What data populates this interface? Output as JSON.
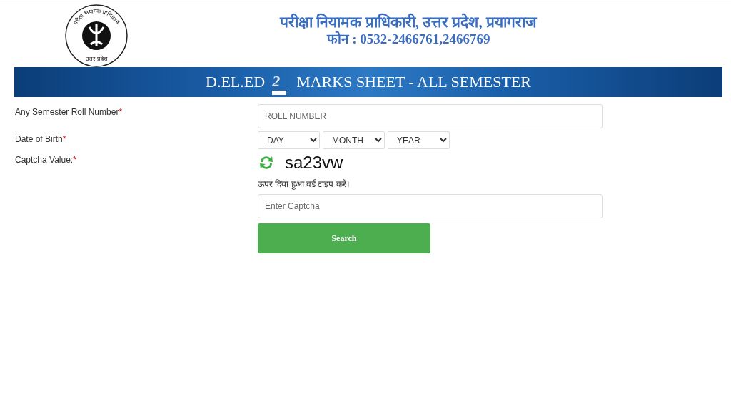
{
  "logo": {
    "arc_text": "परीक्षा नियामक प्राधिकारी",
    "bottom_text": "उत्तर प्रदेश"
  },
  "header": {
    "title": "परीक्षा नियामक प्राधिकारी, उत्तर प्रदेश, प्रयागराज",
    "phone": "फोन : 0532-2466761,2466769"
  },
  "banner": {
    "left": "D.EL.ED",
    "middle": "2",
    "right": "MARKS SHEET - ALL SEMESTER"
  },
  "form": {
    "fields": [
      {
        "kind": "text",
        "label": "Any Semester Roll Number",
        "mark": "*",
        "placeholder": "ROLL NUMBER"
      },
      {
        "kind": "date",
        "label": "Date of Birth",
        "mark": "*",
        "selects": [
          "DAY",
          "MONTH",
          "YEAR"
        ]
      },
      {
        "kind": "captcha",
        "label": "Captcha Value:",
        "mark": "*",
        "code": "sa23vw",
        "hint": "ऊपर दिया हुआ वर्ड टाइप करें।",
        "placeholder": "Enter Captcha"
      }
    ],
    "button": "Search"
  }
}
